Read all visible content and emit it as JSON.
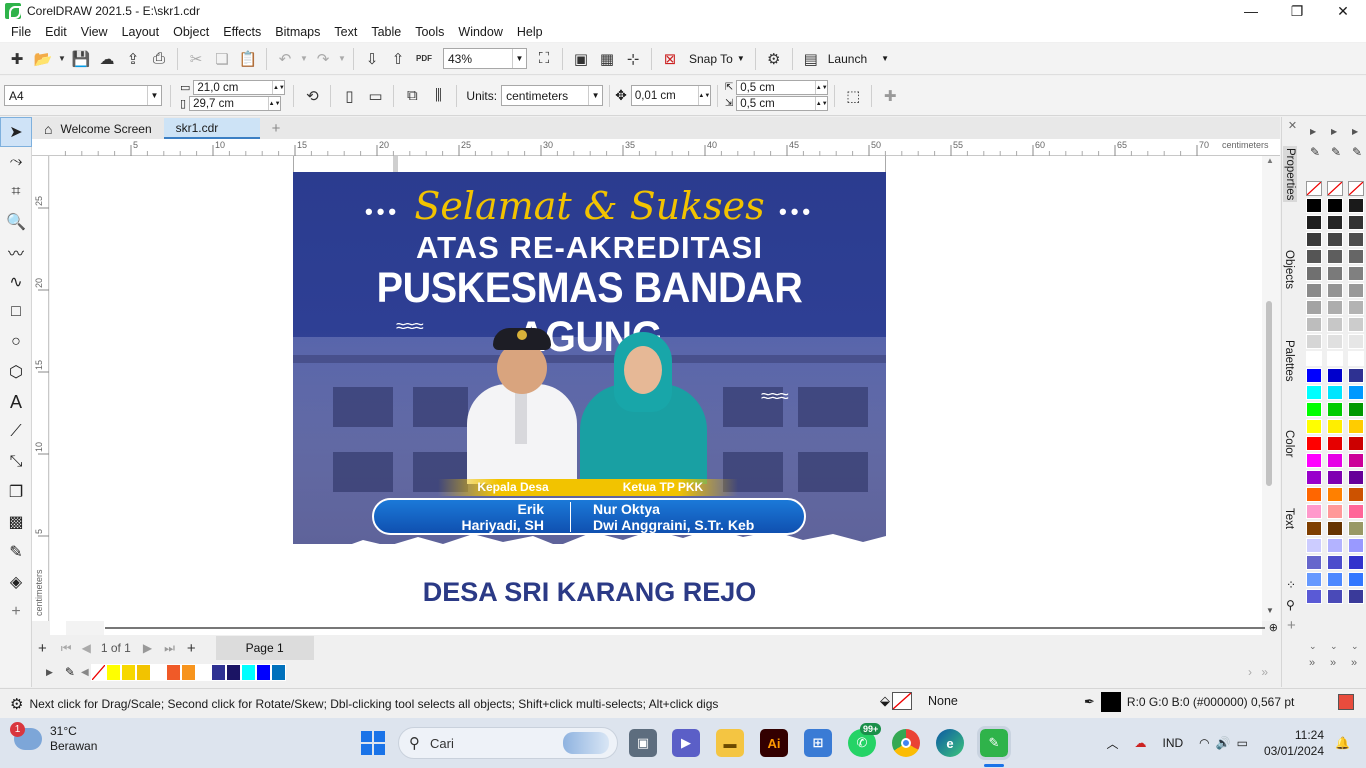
{
  "window": {
    "title": "CorelDRAW 2021.5 - E:\\skr1.cdr",
    "controls": [
      "—",
      "❐",
      "✕"
    ]
  },
  "menu": [
    "File",
    "Edit",
    "View",
    "Layout",
    "Object",
    "Effects",
    "Bitmaps",
    "Text",
    "Table",
    "Tools",
    "Window",
    "Help"
  ],
  "toolbar": {
    "zoom": "43%",
    "pdf_label": "PDF",
    "snap_to": "Snap To",
    "launch": "Launch"
  },
  "propertybar": {
    "page_size": "A4",
    "width": "21,0 cm",
    "height": "29,7 cm",
    "units_label": "Units:",
    "units": "centimeters",
    "nudge": "0,01 cm",
    "dup_x": "0,5 cm",
    "dup_y": "0,5 cm"
  },
  "tabs": {
    "welcome": "Welcome Screen",
    "file": "skr1.cdr",
    "add": "+"
  },
  "ruler": {
    "h_ticks": [
      "5",
      "10",
      "15",
      "20",
      "25",
      "30",
      "35",
      "40",
      "45",
      "50",
      "55",
      "60",
      "65",
      "70"
    ],
    "h_unit": "centimeters",
    "v_ticks": [
      "25",
      "20",
      "15",
      "10",
      "5"
    ],
    "v_unit": "centimeters"
  },
  "poster": {
    "dots": "•••",
    "script_title": "Selamat & Sukses",
    "headline1": "ATAS RE-AKREDITASI",
    "headline2": "PUSKESMAS BANDAR AGUNG",
    "wave": "≈≈≈",
    "role_left": "Kepala Desa",
    "role_right": "Ketua TP PKK",
    "name_left_1": "Erik",
    "name_left_2": "Hariyadi, SH",
    "name_right_1": "Nur Oktya",
    "name_right_2": "Dwi Anggraini, S.Tr. Keb",
    "village": "DESA SRI KARANG REJO"
  },
  "dockers": [
    "Properties",
    "Objects",
    "Palettes",
    "Color",
    "Text"
  ],
  "pagenav": {
    "page_of": "1  of  1",
    "page_tab": "Page 1"
  },
  "colorbar_colors": [
    "#ffff00",
    "#f7d800",
    "#f2c300",
    "#ffffff",
    "#f05a28",
    "#f7941d",
    "#ffffff",
    "#2e3192",
    "#1b1464",
    "#00ffff",
    "#0000ff",
    "#0071bc"
  ],
  "palette_colors": [
    [
      "#000000",
      "#000000",
      "#1a1a1a"
    ],
    [
      "#1f1f1f",
      "#262626",
      "#333333"
    ],
    [
      "#3a3a3a",
      "#444444",
      "#4d4d4d"
    ],
    [
      "#555555",
      "#5e5e5e",
      "#666666"
    ],
    [
      "#707070",
      "#7a7a7a",
      "#808080"
    ],
    [
      "#8a8a8a",
      "#949494",
      "#999999"
    ],
    [
      "#a3a3a3",
      "#adadad",
      "#b3b3b3"
    ],
    [
      "#bdbdbd",
      "#c7c7c7",
      "#cccccc"
    ],
    [
      "#d6d6d6",
      "#e0e0e0",
      "#e6e6e6"
    ],
    [
      "#ffffff",
      "#ffffff",
      "#ffffff"
    ],
    [
      "#0000ff",
      "#0000cc",
      "#2e3192"
    ],
    [
      "#00ffff",
      "#00e5ff",
      "#0099ff"
    ],
    [
      "#00ff00",
      "#00cc00",
      "#009900"
    ],
    [
      "#ffff00",
      "#ffee00",
      "#ffcc00"
    ],
    [
      "#ff0000",
      "#e60000",
      "#cc0000"
    ],
    [
      "#ff00ff",
      "#e600e6",
      "#cc0099"
    ],
    [
      "#9900cc",
      "#7f00b2",
      "#660099"
    ],
    [
      "#ff6600",
      "#ff8000",
      "#cc5200"
    ],
    [
      "#ff99cc",
      "#ff9999",
      "#ff6699"
    ],
    [
      "#7f3f00",
      "#663300",
      "#999966"
    ],
    [
      "#ccccff",
      "#b3b3ff",
      "#9999ff"
    ],
    [
      "#6666cc",
      "#4d4dcc",
      "#3333cc"
    ],
    [
      "#6699ff",
      "#4d88ff",
      "#3377ff"
    ],
    [
      "#5a5ad6",
      "#4a4ab8",
      "#3a3a9a"
    ]
  ],
  "status": {
    "message": "Next click for Drag/Scale; Second click for Rotate/Skew; Dbl-clicking tool selects all objects; Shift+click multi-selects; Alt+click digs",
    "fill": "None",
    "outline": "R:0 G:0 B:0 (#000000)  0,567 pt"
  },
  "taskbar": {
    "weather_temp": "31°C",
    "weather_desc": "Berawan",
    "weather_badge": "1",
    "search": "Cari",
    "whatsapp_badge": "99+",
    "illustrator": "Ai",
    "lang": "IND",
    "time": "11:24",
    "date": "03/01/2024"
  }
}
